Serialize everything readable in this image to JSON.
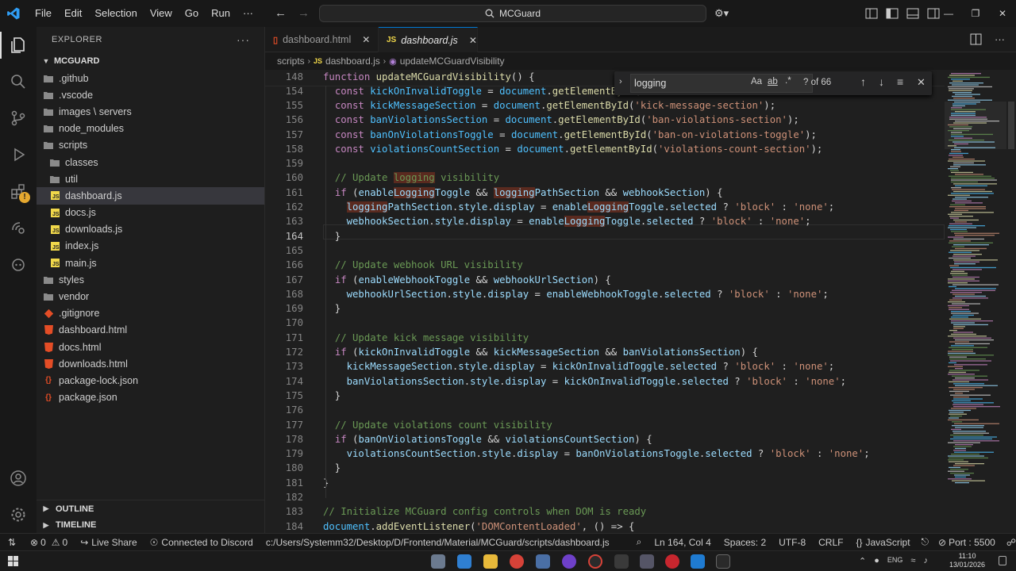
{
  "titlebar": {
    "menu": [
      "File",
      "Edit",
      "Selection",
      "View",
      "Go",
      "Run",
      "···"
    ],
    "search_text": "MCGuard"
  },
  "sidebar": {
    "header": "EXPLORER",
    "root": "MCGUARD",
    "items": [
      {
        "label": ".github",
        "indent": 0,
        "kind": "folder"
      },
      {
        "label": ".vscode",
        "indent": 0,
        "kind": "folder"
      },
      {
        "label": "images \\ servers",
        "indent": 0,
        "kind": "folder"
      },
      {
        "label": "node_modules",
        "indent": 0,
        "kind": "folder"
      },
      {
        "label": "scripts",
        "indent": 0,
        "kind": "folder-open"
      },
      {
        "label": "classes",
        "indent": 1,
        "kind": "folder"
      },
      {
        "label": "util",
        "indent": 1,
        "kind": "folder"
      },
      {
        "label": "dashboard.js",
        "indent": 1,
        "kind": "js",
        "selected": true
      },
      {
        "label": "docs.js",
        "indent": 1,
        "kind": "js"
      },
      {
        "label": "downloads.js",
        "indent": 1,
        "kind": "js"
      },
      {
        "label": "index.js",
        "indent": 1,
        "kind": "js"
      },
      {
        "label": "main.js",
        "indent": 1,
        "kind": "js"
      },
      {
        "label": "styles",
        "indent": 0,
        "kind": "folder"
      },
      {
        "label": "vendor",
        "indent": 0,
        "kind": "folder"
      },
      {
        "label": ".gitignore",
        "indent": 0,
        "kind": "git"
      },
      {
        "label": "dashboard.html",
        "indent": 0,
        "kind": "html"
      },
      {
        "label": "docs.html",
        "indent": 0,
        "kind": "html"
      },
      {
        "label": "downloads.html",
        "indent": 0,
        "kind": "html"
      },
      {
        "label": "package-lock.json",
        "indent": 0,
        "kind": "json"
      },
      {
        "label": "package.json",
        "indent": 0,
        "kind": "json"
      }
    ],
    "outline": "OUTLINE",
    "timeline": "TIMELINE"
  },
  "tabs": [
    {
      "label": "dashboard.html",
      "kind": "html",
      "active": false
    },
    {
      "label": "dashboard.js",
      "kind": "js",
      "active": true
    }
  ],
  "breadcrumb": [
    "scripts",
    "dashboard.js",
    "updateMCGuardVisibility"
  ],
  "find": {
    "query": "logging",
    "case_label": "Aa",
    "word_label": "ab",
    "regex_label": ".*",
    "result": "? of 66"
  },
  "editor": {
    "current_line": "164",
    "lines": [
      {
        "n": "148",
        "t": [
          [
            "kw",
            "function "
          ],
          [
            "fn",
            "updateMCGuardVisibility"
          ],
          [
            "pl",
            "() {"
          ]
        ]
      },
      {
        "n": "154",
        "t": [
          [
            "pl",
            "  "
          ],
          [
            "kw",
            "const "
          ],
          [
            "vr",
            "kickOnInvalidToggle"
          ],
          [
            "pl",
            " = "
          ],
          [
            "vr",
            "document"
          ],
          [
            "pl",
            "."
          ],
          [
            "fn",
            "getElementById"
          ],
          [
            "pl",
            "("
          ]
        ]
      },
      {
        "n": "155",
        "t": [
          [
            "pl",
            "  "
          ],
          [
            "kw",
            "const "
          ],
          [
            "vr",
            "kickMessageSection"
          ],
          [
            "pl",
            " = "
          ],
          [
            "vr",
            "document"
          ],
          [
            "pl",
            "."
          ],
          [
            "fn",
            "getElementById"
          ],
          [
            "pl",
            "("
          ],
          [
            "str",
            "'kick-message-section'"
          ],
          [
            "pl",
            ");"
          ]
        ]
      },
      {
        "n": "156",
        "t": [
          [
            "pl",
            "  "
          ],
          [
            "kw",
            "const "
          ],
          [
            "vr",
            "banViolationsSection"
          ],
          [
            "pl",
            " = "
          ],
          [
            "vr",
            "document"
          ],
          [
            "pl",
            "."
          ],
          [
            "fn",
            "getElementById"
          ],
          [
            "pl",
            "("
          ],
          [
            "str",
            "'ban-violations-section'"
          ],
          [
            "pl",
            ");"
          ]
        ]
      },
      {
        "n": "157",
        "t": [
          [
            "pl",
            "  "
          ],
          [
            "kw",
            "const "
          ],
          [
            "vr",
            "banOnViolationsToggle"
          ],
          [
            "pl",
            " = "
          ],
          [
            "vr",
            "document"
          ],
          [
            "pl",
            "."
          ],
          [
            "fn",
            "getElementById"
          ],
          [
            "pl",
            "("
          ],
          [
            "str",
            "'ban-on-violations-toggle'"
          ],
          [
            "pl",
            ");"
          ]
        ]
      },
      {
        "n": "158",
        "t": [
          [
            "pl",
            "  "
          ],
          [
            "kw",
            "const "
          ],
          [
            "vr",
            "violationsCountSection"
          ],
          [
            "pl",
            " = "
          ],
          [
            "vr",
            "document"
          ],
          [
            "pl",
            "."
          ],
          [
            "fn",
            "getElementById"
          ],
          [
            "pl",
            "("
          ],
          [
            "str",
            "'violations-count-section'"
          ],
          [
            "pl",
            ");"
          ]
        ]
      },
      {
        "n": "159",
        "t": []
      },
      {
        "n": "160",
        "t": [
          [
            "pl",
            "  "
          ],
          [
            "cm",
            "// Update "
          ],
          [
            "cm hl",
            "logging"
          ],
          [
            "cm",
            " visibility"
          ]
        ]
      },
      {
        "n": "161",
        "t": [
          [
            "pl",
            "  "
          ],
          [
            "kw",
            "if "
          ],
          [
            "pl",
            "("
          ],
          [
            "prop",
            "enable"
          ],
          [
            "prop hl",
            "Logging"
          ],
          [
            "prop",
            "Toggle"
          ],
          [
            "pl",
            " && "
          ],
          [
            "prop hl",
            "logging"
          ],
          [
            "prop",
            "PathSection"
          ],
          [
            "pl",
            " && "
          ],
          [
            "prop",
            "webhookSection"
          ],
          [
            "pl",
            ") {"
          ]
        ]
      },
      {
        "n": "162",
        "t": [
          [
            "pl",
            "    "
          ],
          [
            "prop hl",
            "logging"
          ],
          [
            "prop",
            "PathSection"
          ],
          [
            "pl",
            "."
          ],
          [
            "prop",
            "style"
          ],
          [
            "pl",
            "."
          ],
          [
            "prop",
            "display"
          ],
          [
            "pl",
            " = "
          ],
          [
            "prop",
            "enable"
          ],
          [
            "prop hl",
            "Logging"
          ],
          [
            "prop",
            "Toggle"
          ],
          [
            "pl",
            "."
          ],
          [
            "prop",
            "selected"
          ],
          [
            "pl",
            " ? "
          ],
          [
            "str",
            "'block'"
          ],
          [
            "pl",
            " : "
          ],
          [
            "str",
            "'none'"
          ],
          [
            "pl",
            ";"
          ]
        ]
      },
      {
        "n": "163",
        "t": [
          [
            "pl",
            "    "
          ],
          [
            "prop",
            "webhookSection"
          ],
          [
            "pl",
            "."
          ],
          [
            "prop",
            "style"
          ],
          [
            "pl",
            "."
          ],
          [
            "prop",
            "display"
          ],
          [
            "pl",
            " = "
          ],
          [
            "prop",
            "enable"
          ],
          [
            "prop hl",
            "Logging"
          ],
          [
            "prop",
            "Toggle"
          ],
          [
            "pl",
            "."
          ],
          [
            "prop",
            "selected"
          ],
          [
            "pl",
            " ? "
          ],
          [
            "str",
            "'block'"
          ],
          [
            "pl",
            " : "
          ],
          [
            "str",
            "'none'"
          ],
          [
            "pl",
            ";"
          ]
        ]
      },
      {
        "n": "164",
        "t": [
          [
            "pl",
            "  }"
          ]
        ]
      },
      {
        "n": "165",
        "t": []
      },
      {
        "n": "166",
        "t": [
          [
            "pl",
            "  "
          ],
          [
            "cm",
            "// Update webhook URL visibility"
          ]
        ]
      },
      {
        "n": "167",
        "t": [
          [
            "pl",
            "  "
          ],
          [
            "kw",
            "if "
          ],
          [
            "pl",
            "("
          ],
          [
            "prop",
            "enableWebhookToggle"
          ],
          [
            "pl",
            " && "
          ],
          [
            "prop",
            "webhookUrlSection"
          ],
          [
            "pl",
            ") {"
          ]
        ]
      },
      {
        "n": "168",
        "t": [
          [
            "pl",
            "    "
          ],
          [
            "prop",
            "webhookUrlSection"
          ],
          [
            "pl",
            "."
          ],
          [
            "prop",
            "style"
          ],
          [
            "pl",
            "."
          ],
          [
            "prop",
            "display"
          ],
          [
            "pl",
            " = "
          ],
          [
            "prop",
            "enableWebhookToggle"
          ],
          [
            "pl",
            "."
          ],
          [
            "prop",
            "selected"
          ],
          [
            "pl",
            " ? "
          ],
          [
            "str",
            "'block'"
          ],
          [
            "pl",
            " : "
          ],
          [
            "str",
            "'none'"
          ],
          [
            "pl",
            ";"
          ]
        ]
      },
      {
        "n": "169",
        "t": [
          [
            "pl",
            "  }"
          ]
        ]
      },
      {
        "n": "170",
        "t": []
      },
      {
        "n": "171",
        "t": [
          [
            "pl",
            "  "
          ],
          [
            "cm",
            "// Update kick message visibility"
          ]
        ]
      },
      {
        "n": "172",
        "t": [
          [
            "pl",
            "  "
          ],
          [
            "kw",
            "if "
          ],
          [
            "pl",
            "("
          ],
          [
            "prop",
            "kickOnInvalidToggle"
          ],
          [
            "pl",
            " && "
          ],
          [
            "prop",
            "kickMessageSection"
          ],
          [
            "pl",
            " && "
          ],
          [
            "prop",
            "banViolationsSection"
          ],
          [
            "pl",
            ") {"
          ]
        ]
      },
      {
        "n": "173",
        "t": [
          [
            "pl",
            "    "
          ],
          [
            "prop",
            "kickMessageSection"
          ],
          [
            "pl",
            "."
          ],
          [
            "prop",
            "style"
          ],
          [
            "pl",
            "."
          ],
          [
            "prop",
            "display"
          ],
          [
            "pl",
            " = "
          ],
          [
            "prop",
            "kickOnInvalidToggle"
          ],
          [
            "pl",
            "."
          ],
          [
            "prop",
            "selected"
          ],
          [
            "pl",
            " ? "
          ],
          [
            "str",
            "'block'"
          ],
          [
            "pl",
            " : "
          ],
          [
            "str",
            "'none'"
          ],
          [
            "pl",
            ";"
          ]
        ]
      },
      {
        "n": "174",
        "t": [
          [
            "pl",
            "    "
          ],
          [
            "prop",
            "banViolationsSection"
          ],
          [
            "pl",
            "."
          ],
          [
            "prop",
            "style"
          ],
          [
            "pl",
            "."
          ],
          [
            "prop",
            "display"
          ],
          [
            "pl",
            " = "
          ],
          [
            "prop",
            "kickOnInvalidToggle"
          ],
          [
            "pl",
            "."
          ],
          [
            "prop",
            "selected"
          ],
          [
            "pl",
            " ? "
          ],
          [
            "str",
            "'block'"
          ],
          [
            "pl",
            " : "
          ],
          [
            "str",
            "'none'"
          ],
          [
            "pl",
            ";"
          ]
        ]
      },
      {
        "n": "175",
        "t": [
          [
            "pl",
            "  }"
          ]
        ]
      },
      {
        "n": "176",
        "t": []
      },
      {
        "n": "177",
        "t": [
          [
            "pl",
            "  "
          ],
          [
            "cm",
            "// Update violations count visibility"
          ]
        ]
      },
      {
        "n": "178",
        "t": [
          [
            "pl",
            "  "
          ],
          [
            "kw",
            "if "
          ],
          [
            "pl",
            "("
          ],
          [
            "prop",
            "banOnViolationsToggle"
          ],
          [
            "pl",
            " && "
          ],
          [
            "prop",
            "violationsCountSection"
          ],
          [
            "pl",
            ") {"
          ]
        ]
      },
      {
        "n": "179",
        "t": [
          [
            "pl",
            "    "
          ],
          [
            "prop",
            "violationsCountSection"
          ],
          [
            "pl",
            "."
          ],
          [
            "prop",
            "style"
          ],
          [
            "pl",
            "."
          ],
          [
            "prop",
            "display"
          ],
          [
            "pl",
            " = "
          ],
          [
            "prop",
            "banOnViolationsToggle"
          ],
          [
            "pl",
            "."
          ],
          [
            "prop",
            "selected"
          ],
          [
            "pl",
            " ? "
          ],
          [
            "str",
            "'block'"
          ],
          [
            "pl",
            " : "
          ],
          [
            "str",
            "'none'"
          ],
          [
            "pl",
            ";"
          ]
        ]
      },
      {
        "n": "180",
        "t": [
          [
            "pl",
            "  }"
          ]
        ]
      },
      {
        "n": "181",
        "t": [
          [
            "pl",
            "}"
          ]
        ]
      },
      {
        "n": "182",
        "t": []
      },
      {
        "n": "183",
        "t": [
          [
            "cm",
            "// Initialize MCGuard config controls when DOM is ready"
          ]
        ]
      },
      {
        "n": "184",
        "t": [
          [
            "vr",
            "document"
          ],
          [
            "pl",
            "."
          ],
          [
            "fn",
            "addEventListener"
          ],
          [
            "pl",
            "("
          ],
          [
            "str",
            "'DOMContentLoaded'"
          ],
          [
            "pl",
            ", () => {"
          ]
        ]
      }
    ]
  },
  "status": {
    "errors": "0",
    "warnings": "0",
    "live_share": "Live Share",
    "discord": "Connected to Discord",
    "path": "c:/Users/Systemm32/Desktop/D/Frontend/Material/MCGuard/scripts/dashboard.js",
    "position": "Ln 164, Col 4",
    "spaces": "Spaces: 2",
    "encoding": "UTF-8",
    "eol": "CRLF",
    "language": "JavaScript",
    "port": "Port : 5500"
  },
  "taskbar": {
    "time": "11:10",
    "date": "13/01/2026",
    "lang": "ENG"
  },
  "colors": {
    "accent": "#0078d4",
    "js_icon": "#f1d84a",
    "html_icon": "#e44d26",
    "find_highlight": "#5a2a1f"
  }
}
